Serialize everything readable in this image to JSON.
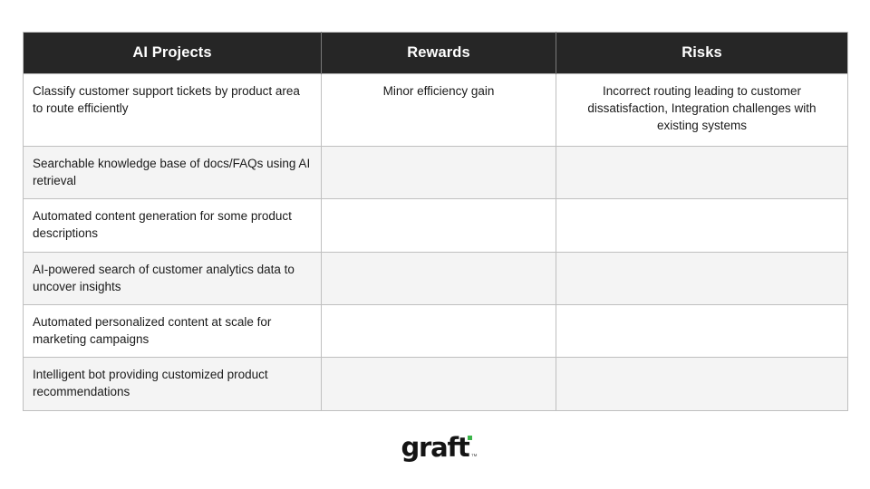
{
  "page": {
    "background_color": "#ffffff"
  },
  "table": {
    "header_bg": "#262626",
    "header_text_color": "#ffffff",
    "row_alt_bg": "#f4f4f4",
    "border_color": "#bfbfbf",
    "columns": [
      {
        "key": "projects",
        "label": "AI Projects"
      },
      {
        "key": "rewards",
        "label": "Rewards"
      },
      {
        "key": "risks",
        "label": "Risks"
      }
    ],
    "rows": [
      {
        "projects": "Classify customer support tickets by product area to route efficiently",
        "rewards": "Minor efficiency gain",
        "risks": "Incorrect routing leading to customer dissatisfaction, Integration challenges with existing systems"
      },
      {
        "projects": "Searchable knowledge base of docs/FAQs using AI retrieval",
        "rewards": "",
        "risks": ""
      },
      {
        "projects": "Automated content generation for some product descriptions",
        "rewards": "",
        "risks": ""
      },
      {
        "projects": "AI-powered search of customer analytics data to uncover insights",
        "rewards": "",
        "risks": ""
      },
      {
        "projects": "Automated personalized content at scale for marketing campaigns",
        "rewards": "",
        "risks": ""
      },
      {
        "projects": "Intelligent bot providing customized product recommendations",
        "rewards": "",
        "risks": ""
      }
    ]
  },
  "logo": {
    "wordmark": "graft",
    "trademark": "™",
    "accent_color": "#3cb54a",
    "text_color": "#141414"
  }
}
